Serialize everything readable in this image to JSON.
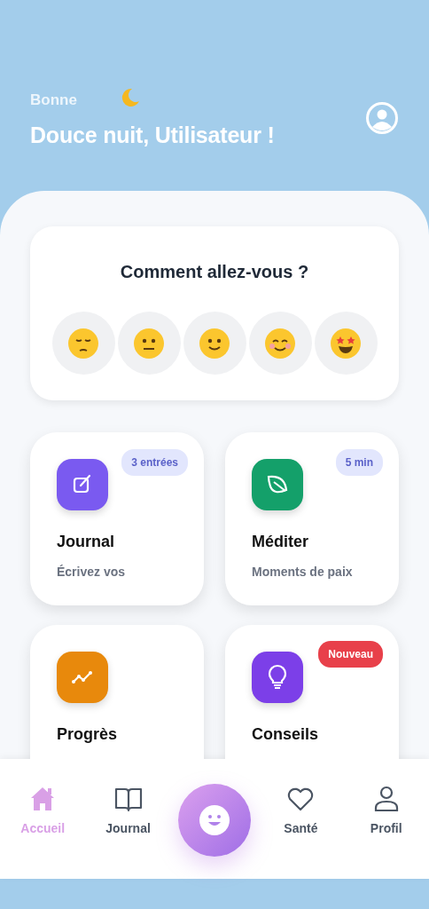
{
  "header": {
    "greeting": "Bonne",
    "title": "Douce nuit, Utilisateur !"
  },
  "mood": {
    "title": "Comment allez-vous ?",
    "options": [
      {
        "kind": "pensive"
      },
      {
        "kind": "neutral"
      },
      {
        "kind": "slight-smile"
      },
      {
        "kind": "smiling"
      },
      {
        "kind": "star-struck"
      }
    ]
  },
  "card_rows": [
    {
      "cards": [
        {
          "title": "Journal",
          "subtitle": "Écrivez vos",
          "kind": "edit",
          "color": "#7a5af0",
          "badge": {
            "kind": "info",
            "text": "3 entrées"
          }
        },
        {
          "title": "Méditer",
          "subtitle": "Moments de paix",
          "kind": "leaf",
          "color": "#14a06a",
          "badge": {
            "kind": "info",
            "text": "5 min"
          }
        }
      ]
    },
    {
      "cards": [
        {
          "title": "Progrès",
          "kind": "chart",
          "color": "#e8890c"
        },
        {
          "title": "Conseils",
          "kind": "bulb",
          "color": "#7c3fe8",
          "badge": {
            "kind": "new",
            "text": "Nouveau"
          }
        }
      ]
    }
  ],
  "nav": [
    {
      "kind": "home",
      "label": "Accueil",
      "selected": true
    },
    {
      "kind": "book",
      "label": "Journal",
      "selected": false
    },
    {
      "kind": "center",
      "selected": false
    },
    {
      "kind": "heart",
      "label": "Santé",
      "selected": false
    },
    {
      "kind": "person",
      "label": "Profil",
      "selected": false
    }
  ]
}
